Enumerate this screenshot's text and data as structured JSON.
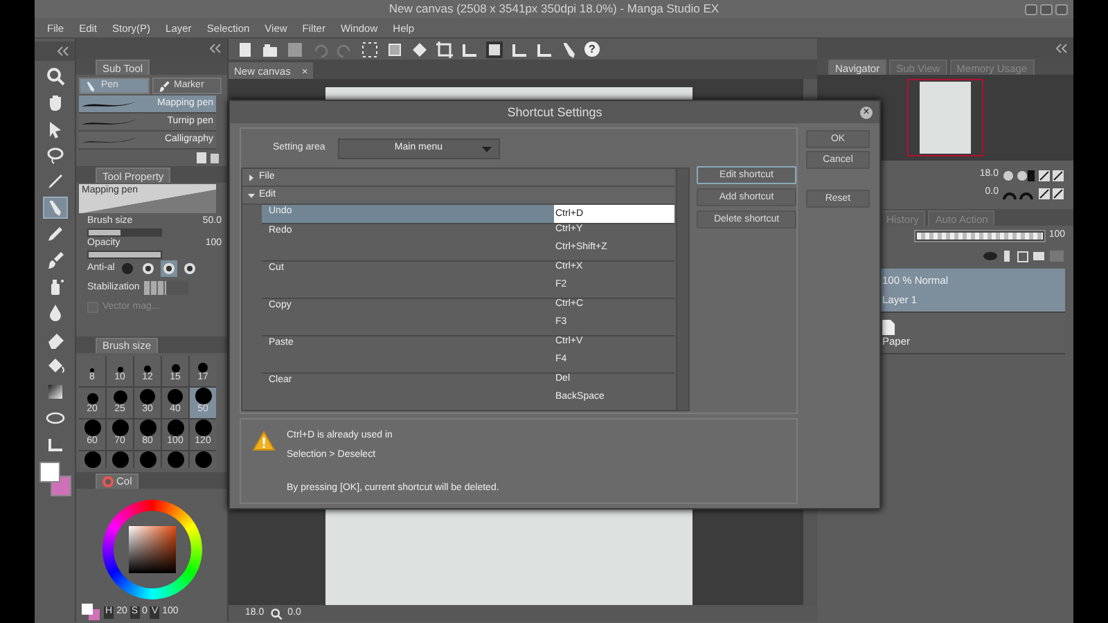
{
  "title_bar": {
    "title": "New canvas (2508 x 3541px 350dpi 18.0%) - Manga Studio EX"
  },
  "menu_bar": [
    "File",
    "Edit",
    "Story(P)",
    "Layer",
    "Selection",
    "View",
    "Filter",
    "Window",
    "Help"
  ],
  "toolbar": {
    "help": "?"
  },
  "sub_tool": {
    "title": "Sub Tool",
    "groups": [
      {
        "label": "Pen",
        "selected": true
      },
      {
        "label": "Marker",
        "selected": false
      }
    ],
    "items": [
      {
        "label": "Mapping pen",
        "selected": true
      },
      {
        "label": "Turnip pen",
        "selected": false
      },
      {
        "label": "Calligraphy",
        "selected": false
      }
    ]
  },
  "tool_property": {
    "title": "Tool Property",
    "preset": "Mapping pen",
    "properties": [
      {
        "kind": "slider",
        "label": "Brush size",
        "value": "50.0",
        "level": 0.45
      },
      {
        "kind": "slider",
        "label": "Opacity",
        "value": "100",
        "level": 1
      },
      {
        "kind": "choice",
        "label": "Anti-al",
        "options": [
          {
            "selected": false
          },
          {
            "selected": false
          },
          {
            "selected": true
          },
          {
            "selected": false
          }
        ]
      },
      {
        "kind": "steps",
        "label": "Stabilization",
        "level": 0.5
      },
      {
        "kind": "check",
        "label": "Vector mag...",
        "checked": false,
        "disabled": true
      }
    ]
  },
  "brush_size": {
    "title": "Brush size",
    "sizes": [
      {
        "label": "8",
        "selected": false
      },
      {
        "label": "10",
        "selected": false
      },
      {
        "label": "12",
        "selected": false
      },
      {
        "label": "15",
        "selected": false
      },
      {
        "label": "17",
        "selected": false
      },
      {
        "label": "20",
        "selected": false
      },
      {
        "label": "25",
        "selected": false
      },
      {
        "label": "30",
        "selected": false
      },
      {
        "label": "40",
        "selected": false
      },
      {
        "label": "50",
        "selected": true
      },
      {
        "label": "60",
        "selected": false
      },
      {
        "label": "70",
        "selected": false
      },
      {
        "label": "80",
        "selected": false
      },
      {
        "label": "100",
        "selected": false
      },
      {
        "label": "120",
        "selected": false
      }
    ]
  },
  "color": {
    "title": "Col",
    "fields": [
      {
        "label": "H",
        "value": "20"
      },
      {
        "label": "S",
        "value": "0"
      },
      {
        "label": "V",
        "value": "100"
      }
    ]
  },
  "canvas": {
    "tab": "New canvas",
    "close": "×",
    "zoom": "18.0",
    "angle": "0.0"
  },
  "navigator": {
    "tabs": [
      {
        "label": "Navigator",
        "selected": true
      },
      {
        "label": "Sub View",
        "selected": false
      },
      {
        "label": "Memory Usage",
        "selected": false
      }
    ],
    "zoom": "18.0",
    "angle": "0.0"
  },
  "layer_panel": {
    "tabs": [
      {
        "label": "History",
        "selected": false
      },
      {
        "label": "Auto Action",
        "selected": false
      }
    ],
    "opacity": "100",
    "opacity_slider": {
      "level": 1
    },
    "layers": [
      {
        "kind": "layer",
        "mode": "100 %  Normal",
        "name": "Layer 1",
        "selected": true
      },
      {
        "kind": "paper",
        "name": "Paper",
        "selected": false
      }
    ]
  },
  "dialog": {
    "title": "Shortcut Settings",
    "close": "×",
    "setting_area": {
      "label": "Setting area",
      "value": "Main menu"
    },
    "tree": [
      {
        "label": "File",
        "expanded": false
      },
      {
        "label": "Edit",
        "expanded": true,
        "children": [
          {
            "label": "Undo",
            "shortcuts": [
              "Ctrl+D"
            ],
            "selected": true,
            "editing": true
          },
          {
            "label": "Redo",
            "shortcuts": [
              "Ctrl+Y",
              "Ctrl+Shift+Z"
            ],
            "selected": false,
            "editing": false
          },
          {
            "label": "Cut",
            "shortcuts": [
              "Ctrl+X",
              "F2"
            ],
            "selected": false,
            "editing": false
          },
          {
            "label": "Copy",
            "shortcuts": [
              "Ctrl+C",
              "F3"
            ],
            "selected": false,
            "editing": false
          },
          {
            "label": "Paste",
            "shortcuts": [
              "Ctrl+V",
              "F4"
            ],
            "selected": false,
            "editing": false
          },
          {
            "label": "Clear",
            "shortcuts": [
              "Del",
              "BackSpace"
            ],
            "selected": false,
            "editing": false
          }
        ]
      }
    ],
    "actions": [
      {
        "label": "Edit shortcut",
        "focused": true
      },
      {
        "label": "Add shortcut",
        "focused": false
      },
      {
        "label": "Delete shortcut",
        "focused": false
      }
    ],
    "buttons": [
      "OK",
      "Cancel",
      "Reset"
    ],
    "message": [
      "Ctrl+D is already used in",
      "Selection > Deselect",
      "By pressing [OK], current shortcut will be deleted."
    ]
  }
}
